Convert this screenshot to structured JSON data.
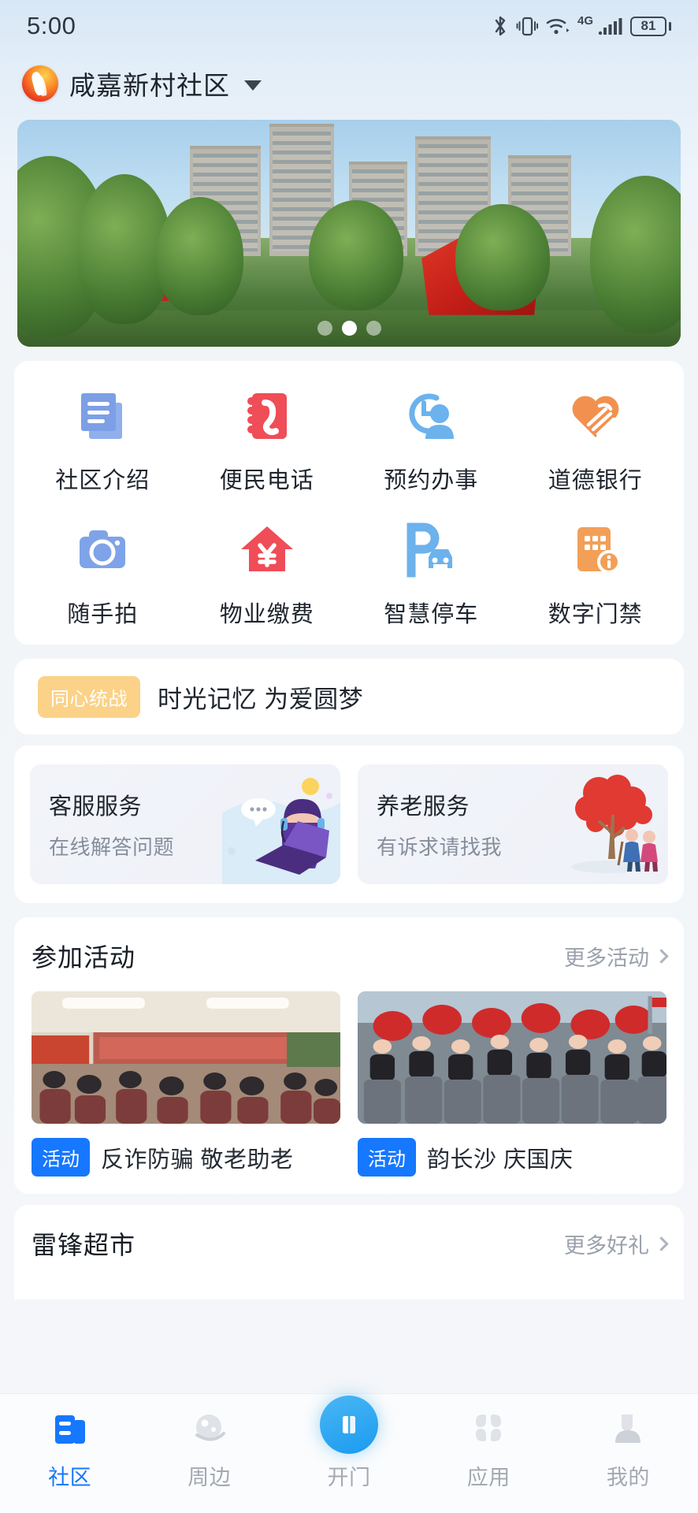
{
  "status_bar": {
    "time": "5:00",
    "battery_level": "81",
    "network_type": "4G",
    "icons": [
      "bluetooth-icon",
      "vibrate-icon",
      "wifi-icon",
      "signal-icon",
      "battery-icon"
    ]
  },
  "header": {
    "community_name": "咸嘉新村社区",
    "logo_name": "community-logo",
    "dropdown_icon": "chevron-down-icon"
  },
  "carousel": {
    "slide_count": 3,
    "active_index": 1
  },
  "quick_actions": [
    {
      "label": "社区介绍",
      "icon": "document-stack-icon",
      "color": "#7fa3e8"
    },
    {
      "label": "便民电话",
      "icon": "phone-book-icon",
      "color": "#ef4d57"
    },
    {
      "label": "预约办事",
      "icon": "clock-person-icon",
      "color": "#6cb2ec"
    },
    {
      "label": "道德银行",
      "icon": "heart-hand-icon",
      "color": "#f2914f"
    },
    {
      "label": "随手拍",
      "icon": "camera-icon",
      "color": "#7fa3e8"
    },
    {
      "label": "物业缴费",
      "icon": "house-yuan-icon",
      "color": "#ef4d57"
    },
    {
      "label": "智慧停车",
      "icon": "parking-car-icon",
      "color": "#6cb2ec"
    },
    {
      "label": "数字门禁",
      "icon": "building-info-icon",
      "color": "#f2a058"
    }
  ],
  "promo": {
    "tag": "同心统战",
    "text": "时光记忆 为爱圆梦",
    "tag_color": "#fbd288"
  },
  "service_cards": [
    {
      "title": "客服服务",
      "subtitle": "在线解答问题",
      "art": "customer-service-illustration"
    },
    {
      "title": "养老服务",
      "subtitle": "有诉求请找我",
      "art": "elderly-care-illustration"
    }
  ],
  "activities_section": {
    "title": "参加活动",
    "more_label": "更多活动",
    "more_icon": "chevron-right-icon",
    "items": [
      {
        "badge": "活动",
        "name": "反诈防骗 敬老助老",
        "image": "community-meeting-photo"
      },
      {
        "badge": "活动",
        "name": "韵长沙 庆国庆",
        "image": "dance-group-photo"
      }
    ],
    "badge_color": "#1677ff"
  },
  "market_section": {
    "title": "雷锋超市",
    "more_label": "更多好礼",
    "more_icon": "chevron-right-icon"
  },
  "bottom_nav": {
    "active_color": "#1677ff",
    "inactive_color": "#a3a9b2",
    "items": [
      {
        "label": "社区",
        "icon": "community-icon",
        "active": true
      },
      {
        "label": "周边",
        "icon": "nearby-planet-icon",
        "active": false
      },
      {
        "label": "开门",
        "icon": "door-open-icon",
        "active": false,
        "center": true
      },
      {
        "label": "应用",
        "icon": "apps-grid-icon",
        "active": false
      },
      {
        "label": "我的",
        "icon": "person-icon",
        "active": false
      }
    ]
  }
}
